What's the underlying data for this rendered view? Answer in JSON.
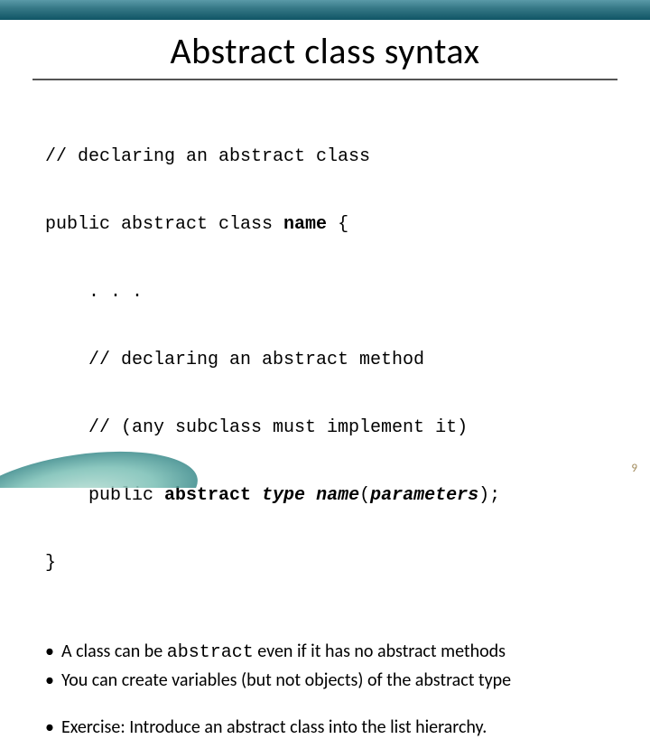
{
  "title": "Abstract class syntax",
  "code": {
    "l1": "// declaring an abstract class",
    "l2a": "public abstract class ",
    "l2b": "name",
    "l2c": " {",
    "l3": ". . .",
    "l4": "// declaring an abstract method",
    "l5": "// (any subclass must implement it)",
    "l6a": "public ",
    "l6b": "abstract",
    "l6c": " ",
    "l6d": "type",
    "l6e": " ",
    "l6f": "name",
    "l6g": "(",
    "l6h": "parameters",
    "l6i": ");",
    "l7": "}"
  },
  "bullets": {
    "b1a": "A class can be ",
    "b1b": "abstract",
    "b1c": " even if it has no abstract methods",
    "b2": "You can create variables (but not objects) of the abstract type",
    "b3": "Exercise: Introduce an abstract class into the list hierarchy."
  },
  "page_number": "9"
}
